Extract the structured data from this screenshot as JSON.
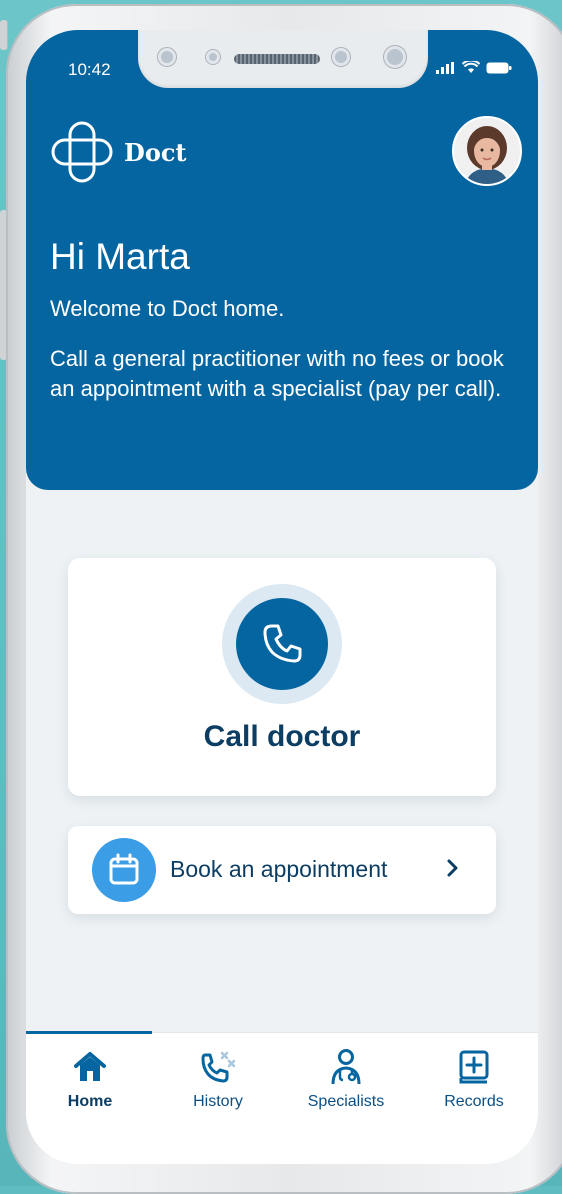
{
  "status_bar": {
    "time": "10:42"
  },
  "brand": {
    "name": "Doct"
  },
  "header": {
    "greeting": "Hi Marta",
    "welcome": "Welcome to Doct home.",
    "description": "Call a general practitioner with no fees or book an appointment with a specialist (pay per call)."
  },
  "call_card": {
    "label": "Call doctor",
    "icon": "phone-icon"
  },
  "book_card": {
    "label": "Book an appointment",
    "icon": "calendar-icon"
  },
  "nav": {
    "items": [
      {
        "label": "Home",
        "icon": "home-icon",
        "active": true
      },
      {
        "label": "History",
        "icon": "call-history-icon",
        "active": false
      },
      {
        "label": "Specialists",
        "icon": "doctor-icon",
        "active": false
      },
      {
        "label": "Records",
        "icon": "medical-record-icon",
        "active": false
      }
    ]
  },
  "colors": {
    "primary": "#0565a1",
    "dark_text": "#0c3d63",
    "accent": "#3a9de6",
    "background": "#eef2f5"
  }
}
